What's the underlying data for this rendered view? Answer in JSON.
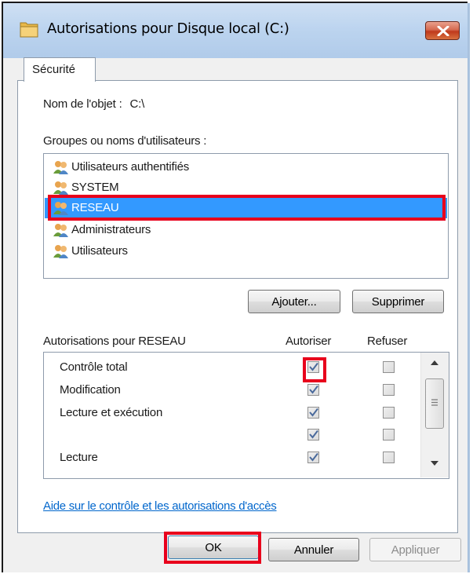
{
  "window": {
    "title": "Autorisations pour Disque local (C:)",
    "close_icon": "close-icon",
    "folder_icon": "folder-icon"
  },
  "tabs": [
    {
      "label": "Sécurité",
      "active": true
    }
  ],
  "object": {
    "label": "Nom de l'objet :",
    "value": "C:\\"
  },
  "users": {
    "label": "Groupes ou noms d'utilisateurs :",
    "items": [
      {
        "name": "Utilisateurs authentifiés",
        "icon": "users-group-icon",
        "selected": false
      },
      {
        "name": "SYSTEM",
        "icon": "users-group-icon",
        "selected": false
      },
      {
        "name": "RESEAU",
        "icon": "users-group-icon",
        "selected": true
      },
      {
        "name": "Administrateurs",
        "icon": "users-group-icon",
        "selected": false
      },
      {
        "name": "Utilisateurs",
        "icon": "users-group-icon",
        "selected": false
      }
    ]
  },
  "buttons": {
    "add": "Ajouter...",
    "remove": "Supprimer",
    "ok": "OK",
    "cancel": "Annuler",
    "apply": "Appliquer"
  },
  "permissions": {
    "label": "Autorisations pour RESEAU",
    "col_allow": "Autoriser",
    "col_deny": "Refuser",
    "rows": [
      {
        "name": "Contrôle total",
        "allow": true,
        "deny": false
      },
      {
        "name": "Modification",
        "allow": true,
        "deny": false
      },
      {
        "name": "Lecture et exécution",
        "allow": true,
        "deny": false
      },
      {
        "name": "",
        "allow": true,
        "deny": false
      },
      {
        "name": "Lecture",
        "allow": true,
        "deny": false
      }
    ]
  },
  "help_link": "Aide sur le contrôle et les autorisations d'accès",
  "colors": {
    "selection": "#3399ff",
    "annotation_red": "#e8001c",
    "link": "#0066cc",
    "title_bar": "#bcd4ef"
  }
}
